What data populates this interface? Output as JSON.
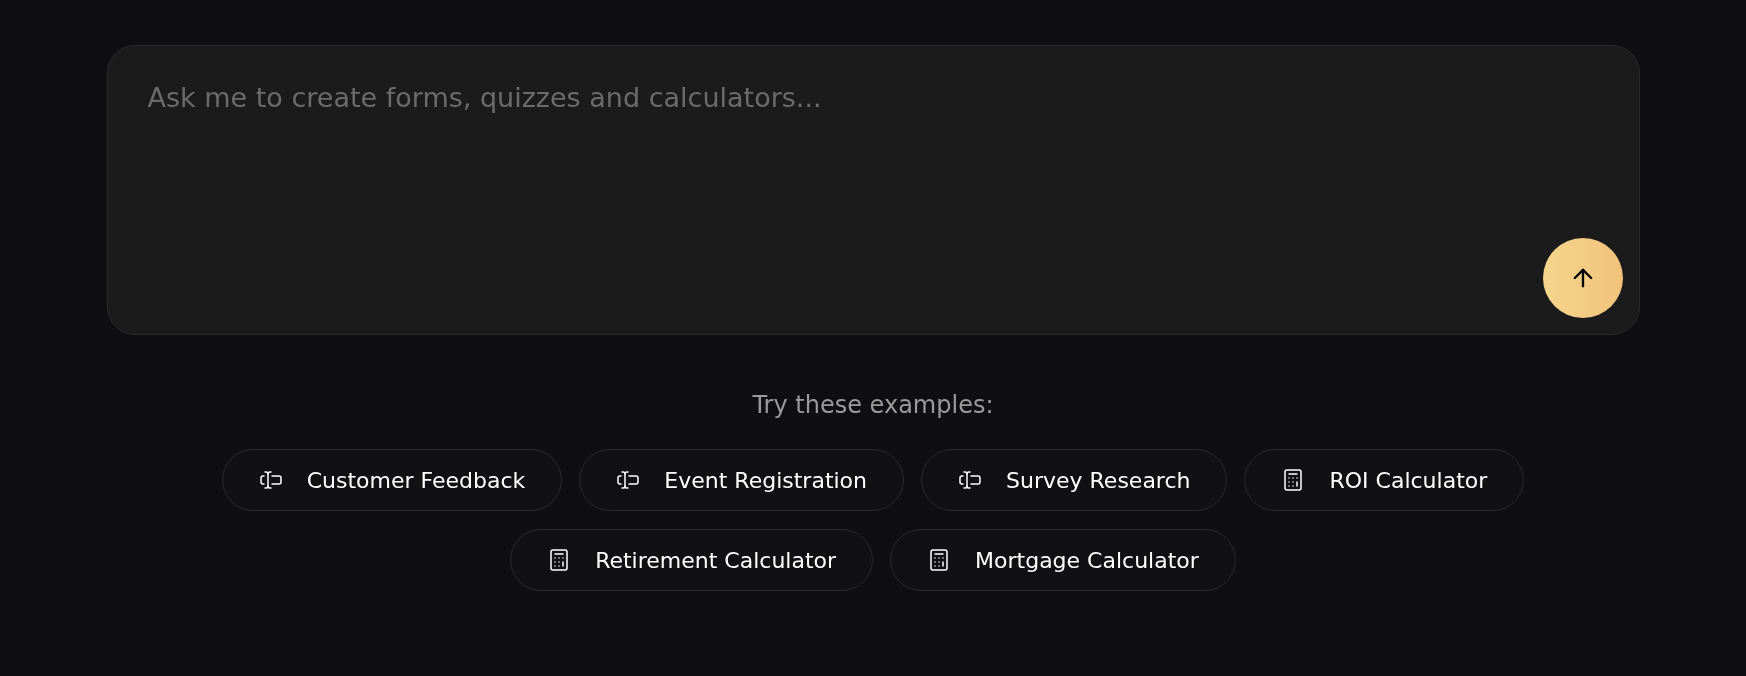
{
  "prompt": {
    "placeholder": "Ask me to create forms, quizzes and calculators..."
  },
  "examples_heading": "Try these examples:",
  "examples": [
    {
      "label": "Customer Feedback",
      "kind": "form"
    },
    {
      "label": "Event Registration",
      "kind": "form"
    },
    {
      "label": "Survey Research",
      "kind": "form"
    },
    {
      "label": "ROI Calculator",
      "kind": "calculator"
    },
    {
      "label": "Retirement Calculator",
      "kind": "calculator"
    },
    {
      "label": "Mortgage Calculator",
      "kind": "calculator"
    }
  ]
}
